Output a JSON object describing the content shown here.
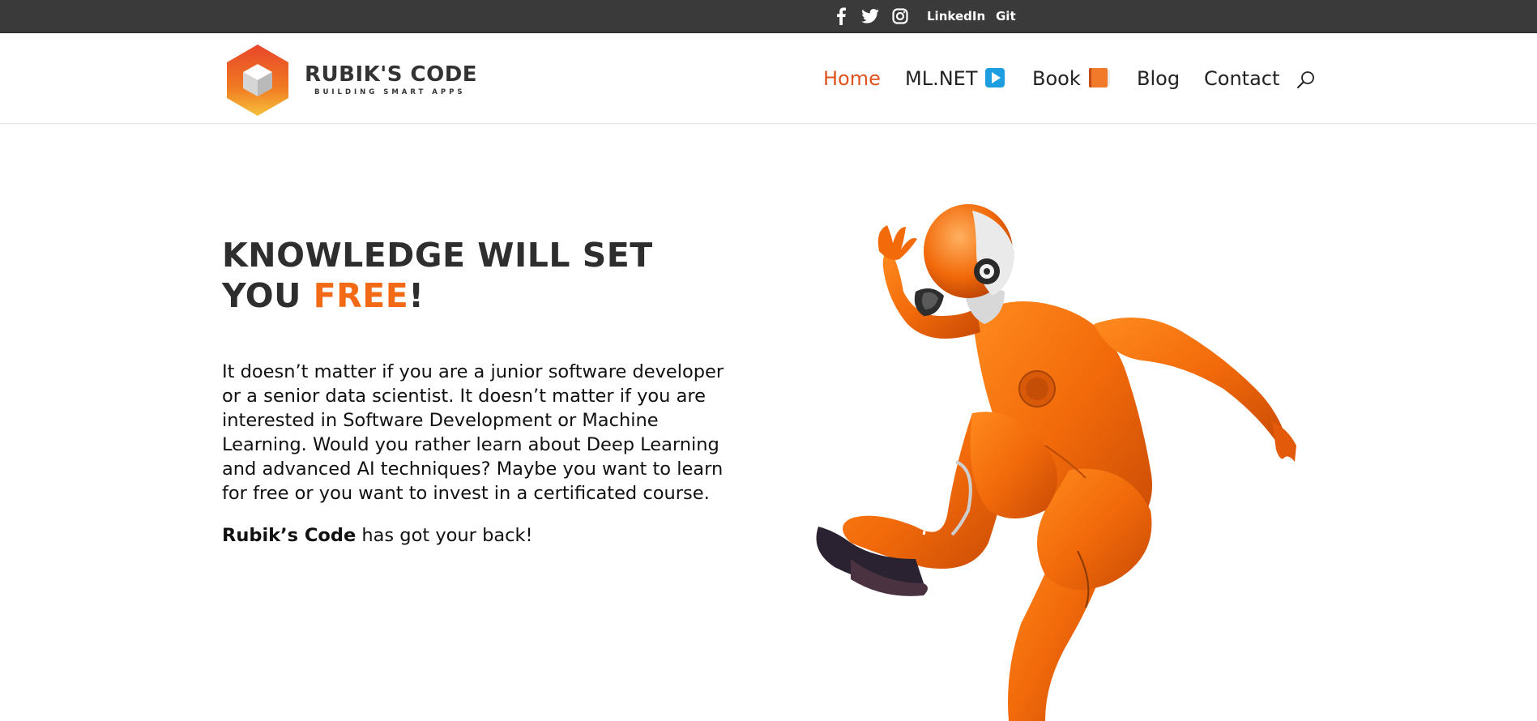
{
  "topbar": {
    "social_icons": [
      "facebook-icon",
      "twitter-icon",
      "instagram-icon"
    ],
    "links": [
      "LinkedIn",
      "Git"
    ]
  },
  "header": {
    "logo": {
      "title": "RUBIK'S CODE",
      "tagline": "BUILDING SMART APPS"
    },
    "nav": [
      {
        "label": "Home",
        "active": true
      },
      {
        "label": "ML.NET",
        "icon": "play-button-emoji"
      },
      {
        "label": "Book",
        "icon": "book-emoji"
      },
      {
        "label": "Blog"
      },
      {
        "label": "Contact"
      }
    ],
    "search_icon": "search-icon"
  },
  "hero": {
    "headline_part1": "KNOWLEDGE WILL SET YOU",
    "headline_accent": "FREE",
    "headline_end": "!",
    "intro": "It doesn’t matter if you are a junior software developer or a senior data scientist. It doesn’t matter if you are interested in Software Development or Machine Learning. Would you rather learn about Deep Learning and advanced AI techniques? Maybe you want to learn for free or you want to invest in a certificated course.",
    "tagline_brand": "Rubik’s Code",
    "tagline_rest": " has got your back!"
  },
  "colors": {
    "accent": "#f26a16",
    "nav_active": "#e0521e",
    "topbar": "#3a3a3a"
  }
}
